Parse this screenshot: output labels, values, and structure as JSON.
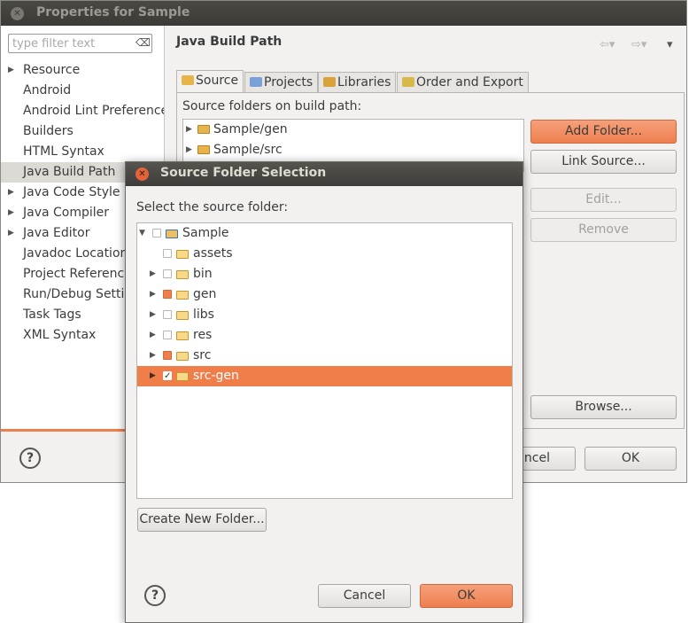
{
  "main_window": {
    "title": "Properties for Sample",
    "filter": {
      "placeholder": "type filter text"
    },
    "nav_items": [
      {
        "label": "Resource",
        "expandable": true
      },
      {
        "label": "Android",
        "expandable": false
      },
      {
        "label": "Android Lint Preferences",
        "expandable": false
      },
      {
        "label": "Builders",
        "expandable": false
      },
      {
        "label": "HTML Syntax",
        "expandable": false
      },
      {
        "label": "Java Build Path",
        "expandable": false,
        "selected": true
      },
      {
        "label": "Java Code Style",
        "expandable": true
      },
      {
        "label": "Java Compiler",
        "expandable": true
      },
      {
        "label": "Java Editor",
        "expandable": true
      },
      {
        "label": "Javadoc Location",
        "expandable": false
      },
      {
        "label": "Project References",
        "expandable": false
      },
      {
        "label": "Run/Debug Settings",
        "expandable": false
      },
      {
        "label": "Task Tags",
        "expandable": false
      },
      {
        "label": "XML Syntax",
        "expandable": false
      }
    ],
    "panel_title": "Java Build Path",
    "tabs": [
      {
        "label": "Source",
        "active": true,
        "icon_color": "#e8b449"
      },
      {
        "label": "Projects",
        "active": false,
        "icon_color": "#7aa0d8"
      },
      {
        "label": "Libraries",
        "active": false,
        "icon_color": "#d9a23a"
      },
      {
        "label": "Order and Export",
        "active": false,
        "icon_color": "#d8b84a"
      }
    ],
    "source_folders_label": "Source folders on build path:",
    "source_folders": [
      {
        "label": "Sample/gen"
      },
      {
        "label": "Sample/src"
      }
    ],
    "buttons": {
      "add_folder": "Add Folder...",
      "link_source": "Link Source...",
      "edit": "Edit...",
      "remove": "Remove",
      "browse": "Browse...",
      "cancel_partial": "ncel",
      "ok": "OK"
    },
    "help_glyph": "?"
  },
  "dialog": {
    "title": "Source Folder Selection",
    "label": "Select the source folder:",
    "tree": [
      {
        "label": "Sample",
        "level": 0,
        "arrow": "down",
        "check": "none",
        "project": true
      },
      {
        "label": "assets",
        "level": 1,
        "arrow": "",
        "check": "none"
      },
      {
        "label": "bin",
        "level": 1,
        "arrow": "right",
        "check": "none"
      },
      {
        "label": "gen",
        "level": 1,
        "arrow": "right",
        "check": "partial"
      },
      {
        "label": "libs",
        "level": 1,
        "arrow": "right",
        "check": "none"
      },
      {
        "label": "res",
        "level": 1,
        "arrow": "right",
        "check": "none"
      },
      {
        "label": "src",
        "level": 1,
        "arrow": "right",
        "check": "partial"
      },
      {
        "label": "src-gen",
        "level": 1,
        "arrow": "right",
        "check": "checked",
        "selected": true
      }
    ],
    "create_folder": "Create New Folder...",
    "cancel": "Cancel",
    "ok": "OK",
    "help_glyph": "?"
  },
  "colors": {
    "accent": "#ef7e4a",
    "titlebar": "#3c3b37",
    "window_bg": "#f2f1f0"
  }
}
